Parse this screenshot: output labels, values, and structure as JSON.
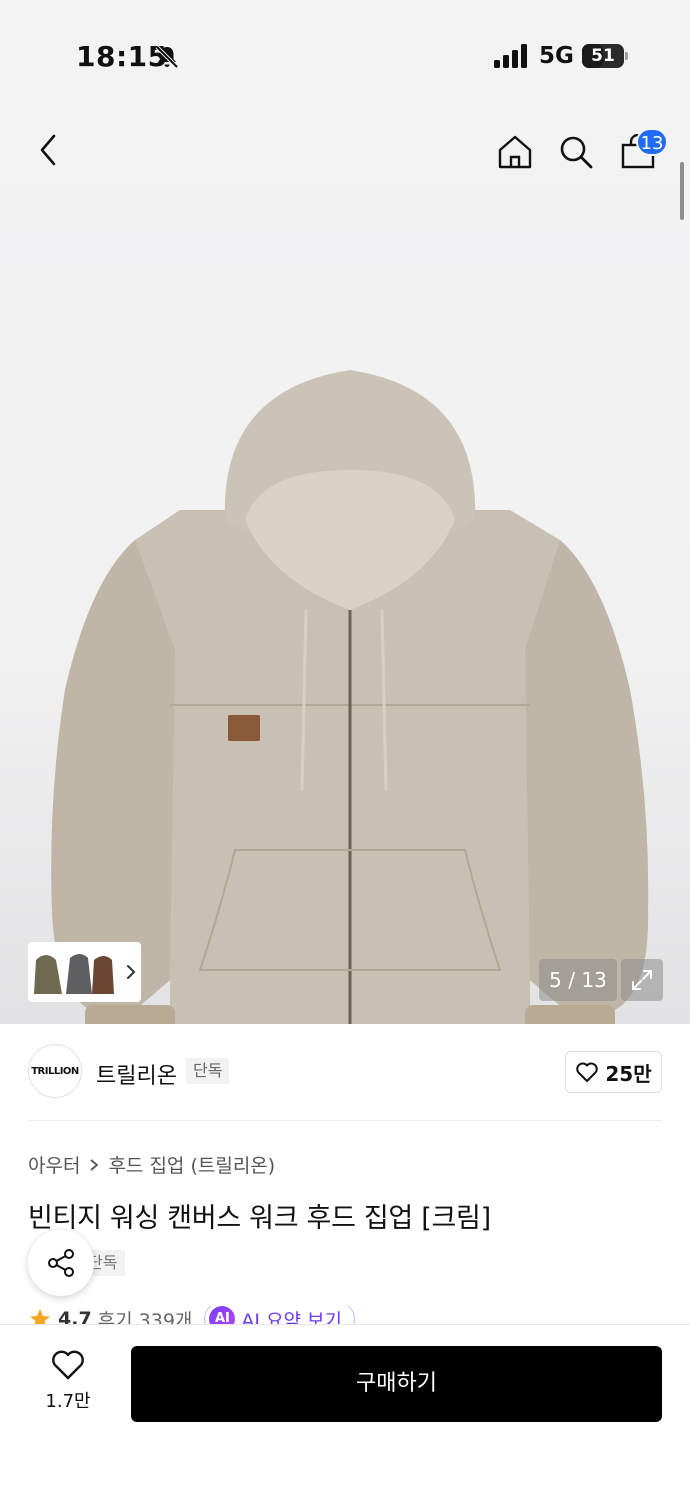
{
  "status_bar": {
    "time": "18:15",
    "network": "5G",
    "battery": "51",
    "battery_level": 0.51
  },
  "top_nav": {
    "back_icon": "chevron-left-icon",
    "home_icon": "home-icon",
    "search_icon": "search-icon",
    "cart_icon": "shopping-bag-icon",
    "cart_count": "13"
  },
  "gallery": {
    "counter": "5 / 13",
    "fullscreen_icon": "expand-icon"
  },
  "brand": {
    "logo_text": "TRILLION",
    "name": "트릴리온",
    "tag": "단독",
    "likes": "25만"
  },
  "product": {
    "breadcrumb": [
      "아우터",
      "후드 집업 (트릴리온)"
    ],
    "title": "빈티지 워싱 캔버스 워크 후드 집업 [크림]",
    "tag": "단독",
    "rating": "4.7",
    "reviews": "후기 339개",
    "ai_badge": "AI",
    "ai_label": "AI 요약 보기"
  },
  "bottom_bar": {
    "wish_count": "1.7만",
    "buy_label": "구매하기"
  },
  "colors": {
    "accent_blue": "#1f6cf2",
    "ai_purple": "#6b3cf0",
    "star": "#f5a623",
    "buy_bg": "#000000"
  }
}
